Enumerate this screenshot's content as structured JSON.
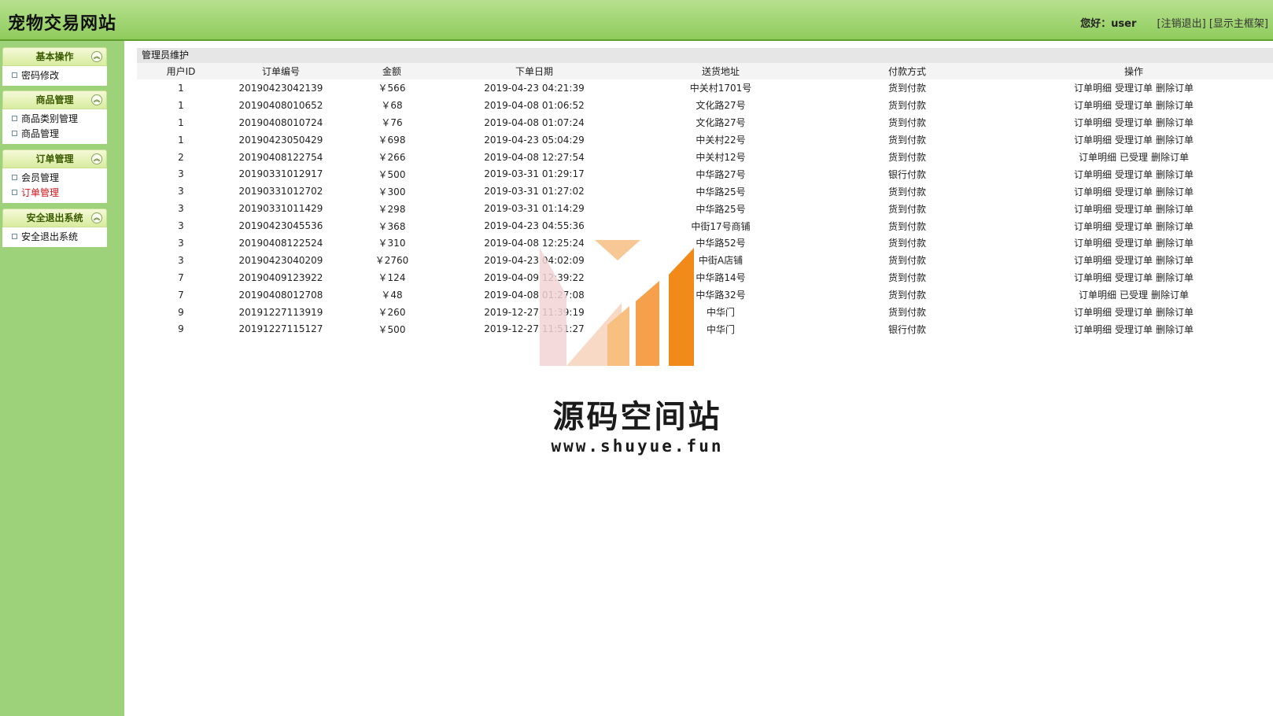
{
  "header": {
    "site_title": "宠物交易网站",
    "greeting": "您好：user",
    "logout_link": "[注销退出]",
    "frame_link": "[显示主框架]"
  },
  "sidebar": {
    "groups": [
      {
        "title": "基本操作",
        "items": [
          {
            "label": "密码修改",
            "active": false
          }
        ]
      },
      {
        "title": "商品管理",
        "items": [
          {
            "label": "商品类别管理",
            "active": false
          },
          {
            "label": "商品管理",
            "active": false
          }
        ]
      },
      {
        "title": "订单管理",
        "items": [
          {
            "label": "会员管理",
            "active": false
          },
          {
            "label": "订单管理",
            "active": true
          }
        ]
      },
      {
        "title": "安全退出系统",
        "items": [
          {
            "label": "安全退出系统",
            "active": false
          }
        ]
      }
    ]
  },
  "main": {
    "panel_title": "管理员维护",
    "columns": [
      "用户ID",
      "订单编号",
      "金额",
      "下单日期",
      "送货地址",
      "付款方式",
      "操作"
    ],
    "rows": [
      {
        "uid": "1",
        "order_no": "20190423042139",
        "amount": "￥566",
        "date": "2019-04-23 04:21:39",
        "address": "中关村1701号",
        "payment": "货到付款",
        "ops": [
          "订单明细",
          "受理订单",
          "删除订单"
        ]
      },
      {
        "uid": "1",
        "order_no": "20190408010652",
        "amount": "￥68",
        "date": "2019-04-08 01:06:52",
        "address": "文化路27号",
        "payment": "货到付款",
        "ops": [
          "订单明细",
          "受理订单",
          "删除订单"
        ]
      },
      {
        "uid": "1",
        "order_no": "20190408010724",
        "amount": "￥76",
        "date": "2019-04-08 01:07:24",
        "address": "文化路27号",
        "payment": "货到付款",
        "ops": [
          "订单明细",
          "受理订单",
          "删除订单"
        ]
      },
      {
        "uid": "1",
        "order_no": "20190423050429",
        "amount": "￥698",
        "date": "2019-04-23 05:04:29",
        "address": "中关村22号",
        "payment": "货到付款",
        "ops": [
          "订单明细",
          "受理订单",
          "删除订单"
        ]
      },
      {
        "uid": "2",
        "order_no": "20190408122754",
        "amount": "￥266",
        "date": "2019-04-08 12:27:54",
        "address": "中关村12号",
        "payment": "货到付款",
        "ops": [
          "订单明细",
          "已受理",
          "删除订单"
        ]
      },
      {
        "uid": "3",
        "order_no": "20190331012917",
        "amount": "￥500",
        "date": "2019-03-31 01:29:17",
        "address": "中华路27号",
        "payment": "银行付款",
        "ops": [
          "订单明细",
          "受理订单",
          "删除订单"
        ]
      },
      {
        "uid": "3",
        "order_no": "20190331012702",
        "amount": "￥300",
        "date": "2019-03-31 01:27:02",
        "address": "中华路25号",
        "payment": "货到付款",
        "ops": [
          "订单明细",
          "受理订单",
          "删除订单"
        ]
      },
      {
        "uid": "3",
        "order_no": "20190331011429",
        "amount": "￥298",
        "date": "2019-03-31 01:14:29",
        "address": "中华路25号",
        "payment": "货到付款",
        "ops": [
          "订单明细",
          "受理订单",
          "删除订单"
        ]
      },
      {
        "uid": "3",
        "order_no": "20190423045536",
        "amount": "￥368",
        "date": "2019-04-23 04:55:36",
        "address": "中街17号商铺",
        "payment": "货到付款",
        "ops": [
          "订单明细",
          "受理订单",
          "删除订单"
        ]
      },
      {
        "uid": "3",
        "order_no": "20190408122524",
        "amount": "￥310",
        "date": "2019-04-08 12:25:24",
        "address": "中华路52号",
        "payment": "货到付款",
        "ops": [
          "订单明细",
          "受理订单",
          "删除订单"
        ]
      },
      {
        "uid": "3",
        "order_no": "20190423040209",
        "amount": "￥2760",
        "date": "2019-04-23 04:02:09",
        "address": "中街A店铺",
        "payment": "货到付款",
        "ops": [
          "订单明细",
          "受理订单",
          "删除订单"
        ]
      },
      {
        "uid": "7",
        "order_no": "20190409123922",
        "amount": "￥124",
        "date": "2019-04-09 12:39:22",
        "address": "中华路14号",
        "payment": "货到付款",
        "ops": [
          "订单明细",
          "受理订单",
          "删除订单"
        ]
      },
      {
        "uid": "7",
        "order_no": "20190408012708",
        "amount": "￥48",
        "date": "2019-04-08 01:27:08",
        "address": "中华路32号",
        "payment": "货到付款",
        "ops": [
          "订单明细",
          "已受理",
          "删除订单"
        ]
      },
      {
        "uid": "9",
        "order_no": "20191227113919",
        "amount": "￥260",
        "date": "2019-12-27 11:39:19",
        "address": "中华门",
        "payment": "货到付款",
        "ops": [
          "订单明细",
          "受理订单",
          "删除订单"
        ]
      },
      {
        "uid": "9",
        "order_no": "20191227115127",
        "amount": "￥500",
        "date": "2019-12-27 11:51:27",
        "address": "中华门",
        "payment": "银行付款",
        "ops": [
          "订单明细",
          "受理订单",
          "删除订单"
        ]
      }
    ]
  },
  "watermark": {
    "title": "源码空间站",
    "url": "www.shuyue.fun"
  },
  "colors": {
    "header_green": "#8fcc5c",
    "sidebar_green": "#9dd27a",
    "accent_red": "#d0141c",
    "logo_orange": "#f28a1a"
  }
}
